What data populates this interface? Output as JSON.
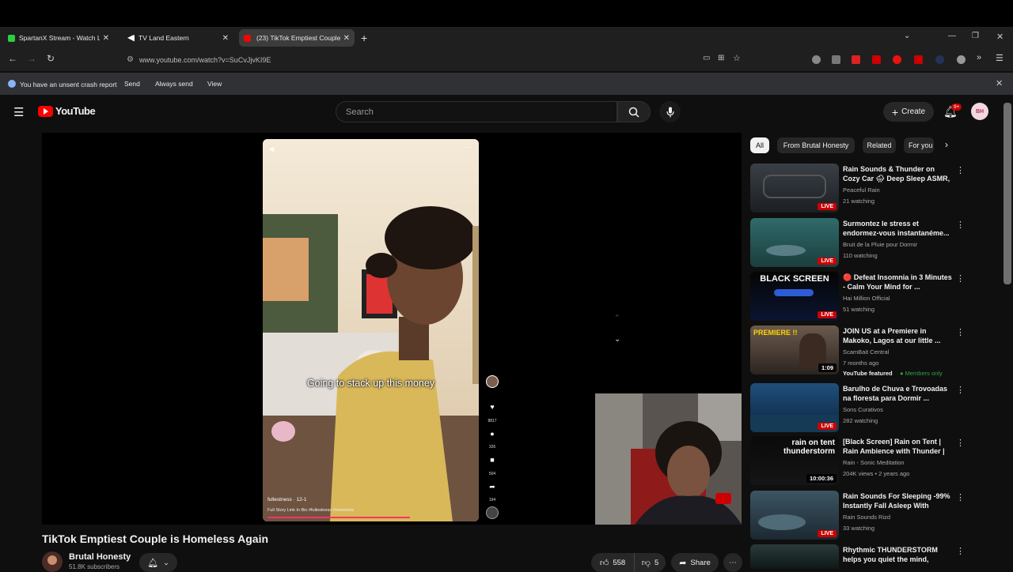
{
  "browser": {
    "tabs": [
      {
        "title": "SpartanX Stream - Watch Live c",
        "favicon_color": "#2ecc40",
        "close": "✕"
      },
      {
        "title": "TV Land Eastern",
        "favicon_color": "#ffffff",
        "close": "✕"
      },
      {
        "title": "(23) TikTok Emptiest Couple",
        "favicon_color": "#ff0000",
        "close": "✕"
      }
    ],
    "new_tab": "+",
    "url": "www.youtube.com/watch?v=SuCvJjvKI9E",
    "window": {
      "minimize": "—",
      "restore": "❐",
      "close": "✕"
    }
  },
  "crash_bar": {
    "message": "You have an unsent crash report",
    "send": "Send",
    "always_send": "Always send",
    "view": "View",
    "close": "✕"
  },
  "youtube": {
    "logo_text": "YouTube",
    "search_placeholder": "Search",
    "create_label": "Create",
    "notification_count": "9+",
    "avatar_text": "BH"
  },
  "player": {
    "caption": "Going to stack up this money",
    "overlay_user": "fullestness · 12-1",
    "overlay_desc": "Full Story Link In Bio #fullestness #homeless",
    "side_counts": {
      "likes": "8817",
      "comments": "326",
      "saves": "504",
      "shares": "194"
    }
  },
  "video": {
    "title": "TikTok Emptiest Couple is Homeless Again",
    "channel": "Brutal Honesty",
    "subscribers": "51.8K subscribers",
    "likes": "558",
    "dislikes": "5",
    "share": "Share"
  },
  "chips": [
    "All",
    "From Brutal Honesty",
    "Related",
    "For you"
  ],
  "recommendations": [
    {
      "title": "Rain Sounds & Thunder on Cozy Car 🌧 Deep Sleep ASMR, Cal...",
      "channel": "Peaceful Rain",
      "meta": "21 watching",
      "badge": "LIVE",
      "colors": [
        "#3a4046",
        "#1b1f24"
      ]
    },
    {
      "title": "Surmontez le stress et endormez-vous instantanéme...",
      "channel": "Bruit de la Pluie pour Dormir",
      "meta": "110 watching",
      "badge": "LIVE",
      "colors": [
        "#2f6b6a",
        "#1c3d3e"
      ]
    },
    {
      "title": "🔴 Defeat Insomnia in 3 Minutes - Calm Your Mind for ...",
      "channel": "Hai Million Official",
      "meta": "51 watching",
      "badge": "LIVE",
      "thumb_text": "BLACK SCREEN",
      "colors": [
        "#050505",
        "#0b1530"
      ]
    },
    {
      "title": "JOIN US at a Premiere in Makoko, Lagos at our little ...",
      "channel": "ScamBait Central",
      "meta": "7 months ago",
      "featured": "YouTube featured",
      "members": "Members only",
      "badge": "1:09",
      "thumb_text": "PREMIERE !!",
      "colors": [
        "#6b5a4c",
        "#2c2420"
      ]
    },
    {
      "title": "Barulho de Chuva e Trovoadas na floresta para Dormir ...",
      "channel": "Sons Curativos",
      "meta": "282 watching",
      "badge": "LIVE",
      "colors": [
        "#1f4f7a",
        "#0c2440"
      ]
    },
    {
      "title": "[Black Screen] Rain on Tent | Rain Ambience with Thunder | ...",
      "channel": "Rain - Sonic Meditation",
      "meta": "204K views • 2 years ago",
      "badge": "10:00:36",
      "thumb_text": "rain on tent",
      "thumb_text2": "thunderstorm",
      "colors": [
        "#0a0a0a",
        "#151515"
      ]
    },
    {
      "title": "Rain Sounds For Sleeping -99% Instantly Fall Asleep With Rain...",
      "channel": "Rain Sounds Rizd",
      "meta": "33 watching",
      "badge": "LIVE",
      "colors": [
        "#3d5563",
        "#1b2831"
      ]
    },
    {
      "title": "Rhythmic THUNDERSTORM helps you quiet the mind, easo...",
      "channel": "",
      "meta": "",
      "badge": "",
      "colors": [
        "#2a3a3a",
        "#0f1818"
      ]
    }
  ]
}
